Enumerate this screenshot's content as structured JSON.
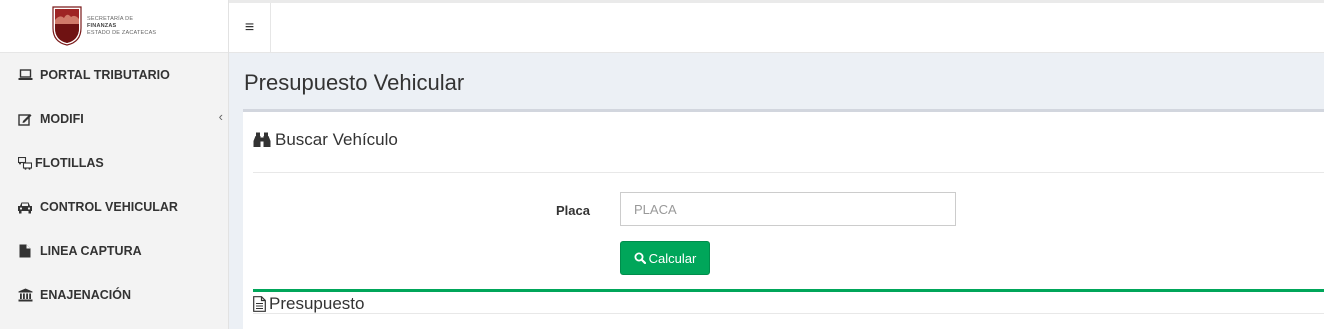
{
  "logo": {
    "line1": "SECRETARÍA DE",
    "line2": "FINANZAS",
    "line3": "ESTADO DE ZACATECAS"
  },
  "sidebar": {
    "items": [
      {
        "label": "PORTAL TRIBUTARIO",
        "icon": "laptop-icon"
      },
      {
        "label": "MODIFI",
        "icon": "edit-icon",
        "chevron": "‹"
      },
      {
        "label": "FLOTILLAS",
        "icon": "fleet-icon"
      },
      {
        "label": "CONTROL VEHICULAR",
        "icon": "car-icon"
      },
      {
        "label": "LINEA CAPTURA",
        "icon": "file-icon"
      },
      {
        "label": "ENAJENACIÓN",
        "icon": "bank-icon"
      }
    ]
  },
  "topbar": {
    "menu_glyph": "≡"
  },
  "page": {
    "title": "Presupuesto Vehicular"
  },
  "search_box": {
    "title": "Buscar Vehículo",
    "placa_label": "Placa",
    "placa_placeholder": "PLACA",
    "placa_value": "",
    "button_label": "Calcular"
  },
  "budget_box": {
    "title": "Presupuesto"
  },
  "colors": {
    "accent_green": "#00a65a",
    "content_bg": "#ecf0f5",
    "sidebar_bg": "#f3f3f3"
  }
}
